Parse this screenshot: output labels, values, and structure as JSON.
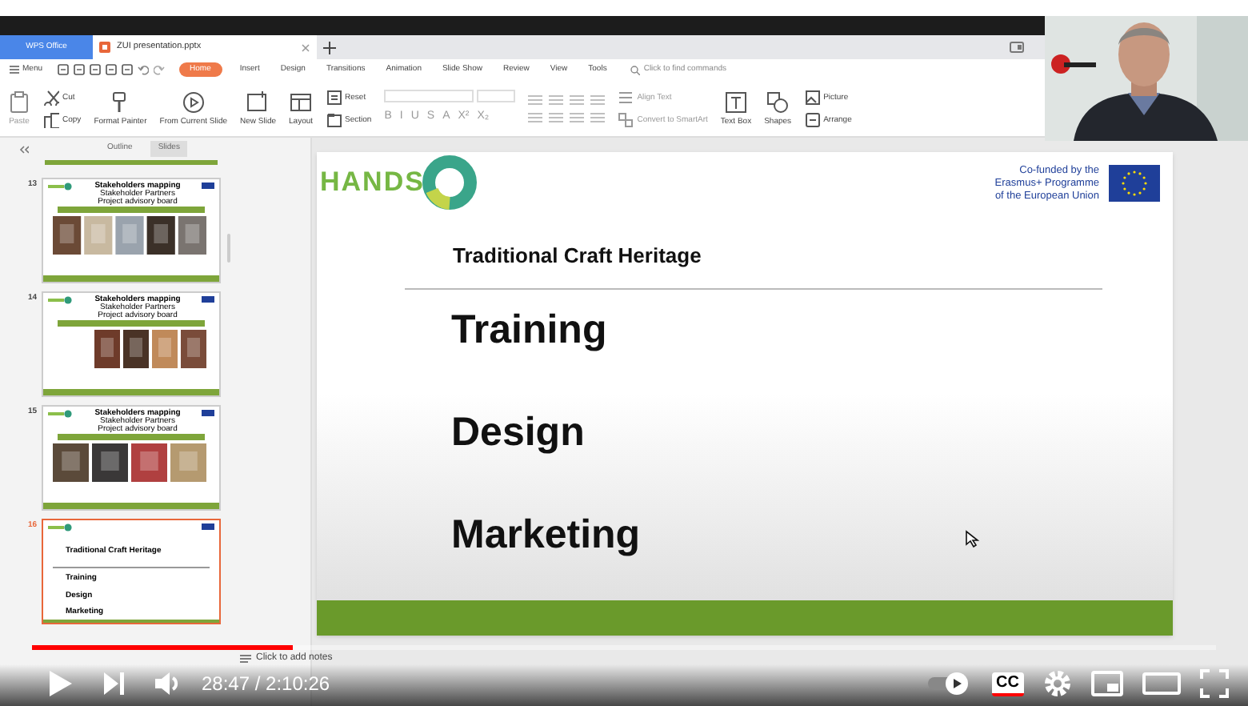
{
  "window_tabs": [
    {
      "label": "WPS Office",
      "kind": "home",
      "selected": false
    },
    {
      "label": "ZUI presentation.pptx",
      "kind": "document",
      "selected": true
    }
  ],
  "menu": {
    "label": "Menu"
  },
  "ribbon_tabs": [
    {
      "label": "Home",
      "selected": true
    },
    {
      "label": "Insert",
      "selected": false
    },
    {
      "label": "Design",
      "selected": false
    },
    {
      "label": "Transitions",
      "selected": false
    },
    {
      "label": "Animation",
      "selected": false
    },
    {
      "label": "Slide Show",
      "selected": false
    },
    {
      "label": "Review",
      "selected": false
    },
    {
      "label": "View",
      "selected": false
    },
    {
      "label": "Tools",
      "selected": false
    }
  ],
  "search": {
    "placeholder": "Click to find commands"
  },
  "ribbon_left": [
    {
      "label": "Paste",
      "kind": "paste"
    },
    {
      "label": "Cut",
      "kind": "cut"
    },
    {
      "label": "Copy",
      "kind": "copy"
    },
    {
      "label": "Format Painter",
      "kind": "painter"
    },
    {
      "label": "From Current Slide",
      "kind": "play"
    },
    {
      "label": "New Slide",
      "kind": "newslide"
    },
    {
      "label": "Layout",
      "kind": "layout"
    },
    {
      "label": "Reset",
      "kind": "reset"
    },
    {
      "label": "Section",
      "kind": "section"
    }
  ],
  "format_buttons": [
    "B",
    "I",
    "U",
    "S",
    "A",
    "X²",
    "X₂"
  ],
  "ribbon_right": [
    {
      "label": "Align Text",
      "kind": "align"
    },
    {
      "label": "Convert to SmartArt",
      "kind": "smartart"
    },
    {
      "label": "Text Box",
      "kind": "textbox"
    },
    {
      "label": "Shapes",
      "kind": "shapes"
    },
    {
      "label": "Picture",
      "kind": "picture"
    },
    {
      "label": "Arrange",
      "kind": "arrange"
    }
  ],
  "panel": {
    "tabs": [
      {
        "label": "Outline",
        "selected": false
      },
      {
        "label": "Slides",
        "selected": true
      }
    ],
    "slides": [
      {
        "number": "13",
        "kind": "photos",
        "title": "Stakeholders mapping",
        "subtitle": "Stakeholder Partners",
        "note": "Project advisory board",
        "selected": false
      },
      {
        "number": "14",
        "kind": "photos",
        "title": "Stakeholders mapping",
        "subtitle": "Stakeholder Partners",
        "note": "Project advisory board",
        "selected": false
      },
      {
        "number": "15",
        "kind": "photos",
        "title": "Stakeholders mapping",
        "subtitle": "Stakeholder Partners",
        "note": "Project advisory board",
        "selected": false
      },
      {
        "number": "16",
        "kind": "bullets",
        "title": "Traditional Craft Heritage",
        "bullets": [
          "Training",
          "Design",
          "Marketing"
        ],
        "selected": true
      }
    ]
  },
  "slide": {
    "logo": "HANDS",
    "funding": [
      "Co-funded by the",
      "Erasmus+ Programme",
      "of the European Union"
    ],
    "heading": "Traditional Craft Heritage",
    "bullets": [
      "Training",
      "Design",
      "Marketing"
    ]
  },
  "notes": {
    "placeholder": "Click to add notes"
  },
  "player": {
    "progress": {
      "level": 0.22
    },
    "time": "28:47 / 2:10:26",
    "captions": {
      "label": "CC",
      "on": true
    }
  }
}
